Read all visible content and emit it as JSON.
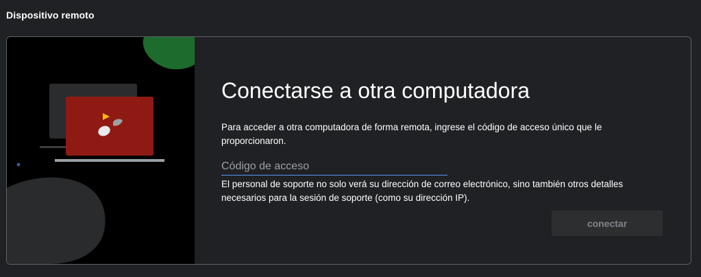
{
  "page": {
    "section_title": "Dispositivo remoto"
  },
  "connect_card": {
    "title": "Conectarse a otra computadora",
    "description": "Para acceder a otra computadora de forma remota, ingrese el código de acceso único que le proporcionaron.",
    "access_code": {
      "value": "",
      "placeholder": "Código de acceso"
    },
    "notice": "El personal de soporte no solo verá su dirección de correo electrónico, sino también otros detalles necesarios para la sesión de soporte (como su dirección IP).",
    "connect_label": "conectar"
  },
  "colors": {
    "background": "#202124",
    "illustration_bg": "#000000",
    "laptop_screen_red": "#8f1a14",
    "green_blob": "#1e6b2e",
    "accent_blue": "#5e97f6",
    "disabled_text": "#80868b"
  },
  "icons": {
    "illustration": "remote-desktop-illustration"
  }
}
